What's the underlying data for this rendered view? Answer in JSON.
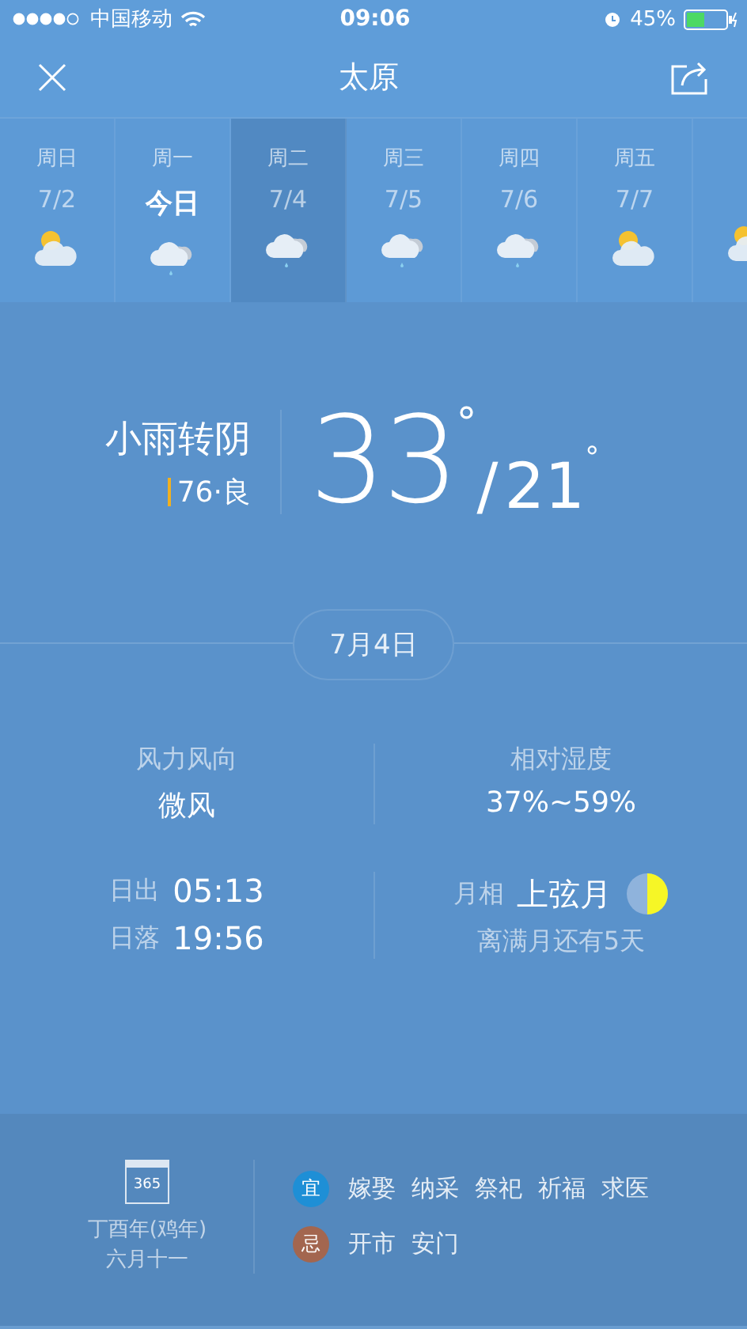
{
  "status_bar": {
    "carrier": "中国移动",
    "time": "09:06",
    "battery": "45%"
  },
  "header": {
    "title": "太原"
  },
  "days": [
    {
      "weekday": "周日",
      "date": "7/2",
      "kind": "sun-cloud",
      "selected": false,
      "today": false
    },
    {
      "weekday": "周一",
      "date": "今日",
      "kind": "rain",
      "selected": false,
      "today": true
    },
    {
      "weekday": "周二",
      "date": "7/4",
      "kind": "rain",
      "selected": true,
      "today": false
    },
    {
      "weekday": "周三",
      "date": "7/5",
      "kind": "rain",
      "selected": false,
      "today": false
    },
    {
      "weekday": "周四",
      "date": "7/6",
      "kind": "rain",
      "selected": false,
      "today": false
    },
    {
      "weekday": "周五",
      "date": "7/7",
      "kind": "sun-cloud",
      "selected": false,
      "today": false
    },
    {
      "kind": "sun-cloud",
      "selected": false
    }
  ],
  "current": {
    "condition": "小雨转阴",
    "aqi": "76·良",
    "high": "33",
    "degree": "°",
    "slash": "/",
    "low": "21",
    "low_degree": "°"
  },
  "date_pill": "7月4日",
  "details": {
    "wind_label": "风力风向",
    "wind_value": "微风",
    "humidity_label": "相对湿度",
    "humidity_value": "37%~59%",
    "sunrise_label": "日出",
    "sunrise": "05:13",
    "sunset_label": "日落",
    "sunset": "19:56",
    "moon_label": "月相",
    "moon_phase": "上弦月",
    "full_moon_note": "离满月还有5天"
  },
  "almanac": {
    "calendar_number": "365",
    "year": "丁酉年(鸡年)",
    "lunar_date": "六月十一",
    "rows": [
      {
        "badge": "宜",
        "color": "#1e8fd6",
        "items": [
          "嫁娶",
          "纳采",
          "祭祀",
          "祈福",
          "求医"
        ]
      },
      {
        "badge": "忌",
        "color": "#a3664f",
        "items": [
          "开市",
          "安门"
        ]
      }
    ]
  }
}
